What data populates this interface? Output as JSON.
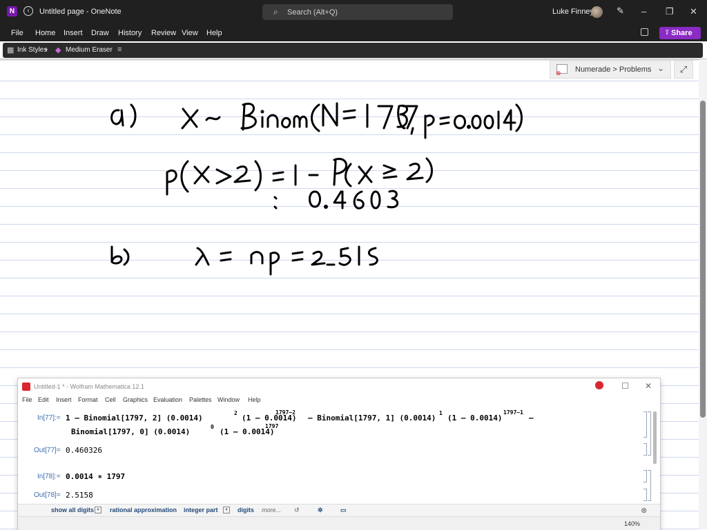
{
  "window": {
    "title": "Untitled page  -  OneNote",
    "search_placeholder": "Search (Alt+Q)",
    "user_name": "Luke Finney",
    "share_label": "Share"
  },
  "menu": [
    "File",
    "Home",
    "Insert",
    "Draw",
    "History",
    "Review",
    "View",
    "Help"
  ],
  "ink_toolbar": {
    "ink_styles_label": "Ink Styles",
    "eraser_label": "Medium Eraser"
  },
  "notebook_breadcrumb": "Numerade > Problems",
  "handwritten_notes": {
    "line1": "a)   X ~ Binom(N=1797, p=0.0014)",
    "line2": "P(X > 2) = 1 - P(X ≤ 2)",
    "line3": "= 0.4603",
    "line4": "b)   λ = np = 2.515"
  },
  "mathematica": {
    "title": "Untitled-1 * - Wolfram Mathematica 12.1",
    "menu": [
      "File",
      "Edit",
      "Insert",
      "Format",
      "Cell",
      "Graphics",
      "Evaluation",
      "Palettes",
      "Window",
      "Help"
    ],
    "cells": {
      "in77_label": "In[77]:=",
      "in77_line1_a": "1 – Binomial[1797, 2] (0.0014)",
      "in77_sup1": "2",
      "in77_line1_b": "(1 – 0.0014)",
      "in77_sup2": "1797−2",
      "in77_line1_c": "– Binomial[1797, 1] (0.0014)",
      "in77_sup3": "1",
      "in77_line1_d": "(1 – 0.0014)",
      "in77_sup4": "1797−1",
      "in77_line1_e": "–",
      "in77_line2_a": "Binomial[1797, 0] (0.0014)",
      "in77_sup5": "0",
      "in77_line2_b": "(1 – 0.0014)",
      "in77_sup6": "1797",
      "out77_label": "Out[77]=",
      "out77_value": "0.460326",
      "in78_label": "In[78]:=",
      "in78_code": "0.0014 ∗ 1797",
      "out78_label": "Out[78]=",
      "out78_value": "2.5158"
    },
    "suggestions": {
      "show_all_digits": "show all digits",
      "rational_approximation": "rational approximation",
      "integer_part": "integer part",
      "digits": "digits",
      "more": "more..."
    },
    "zoom": "140%"
  }
}
